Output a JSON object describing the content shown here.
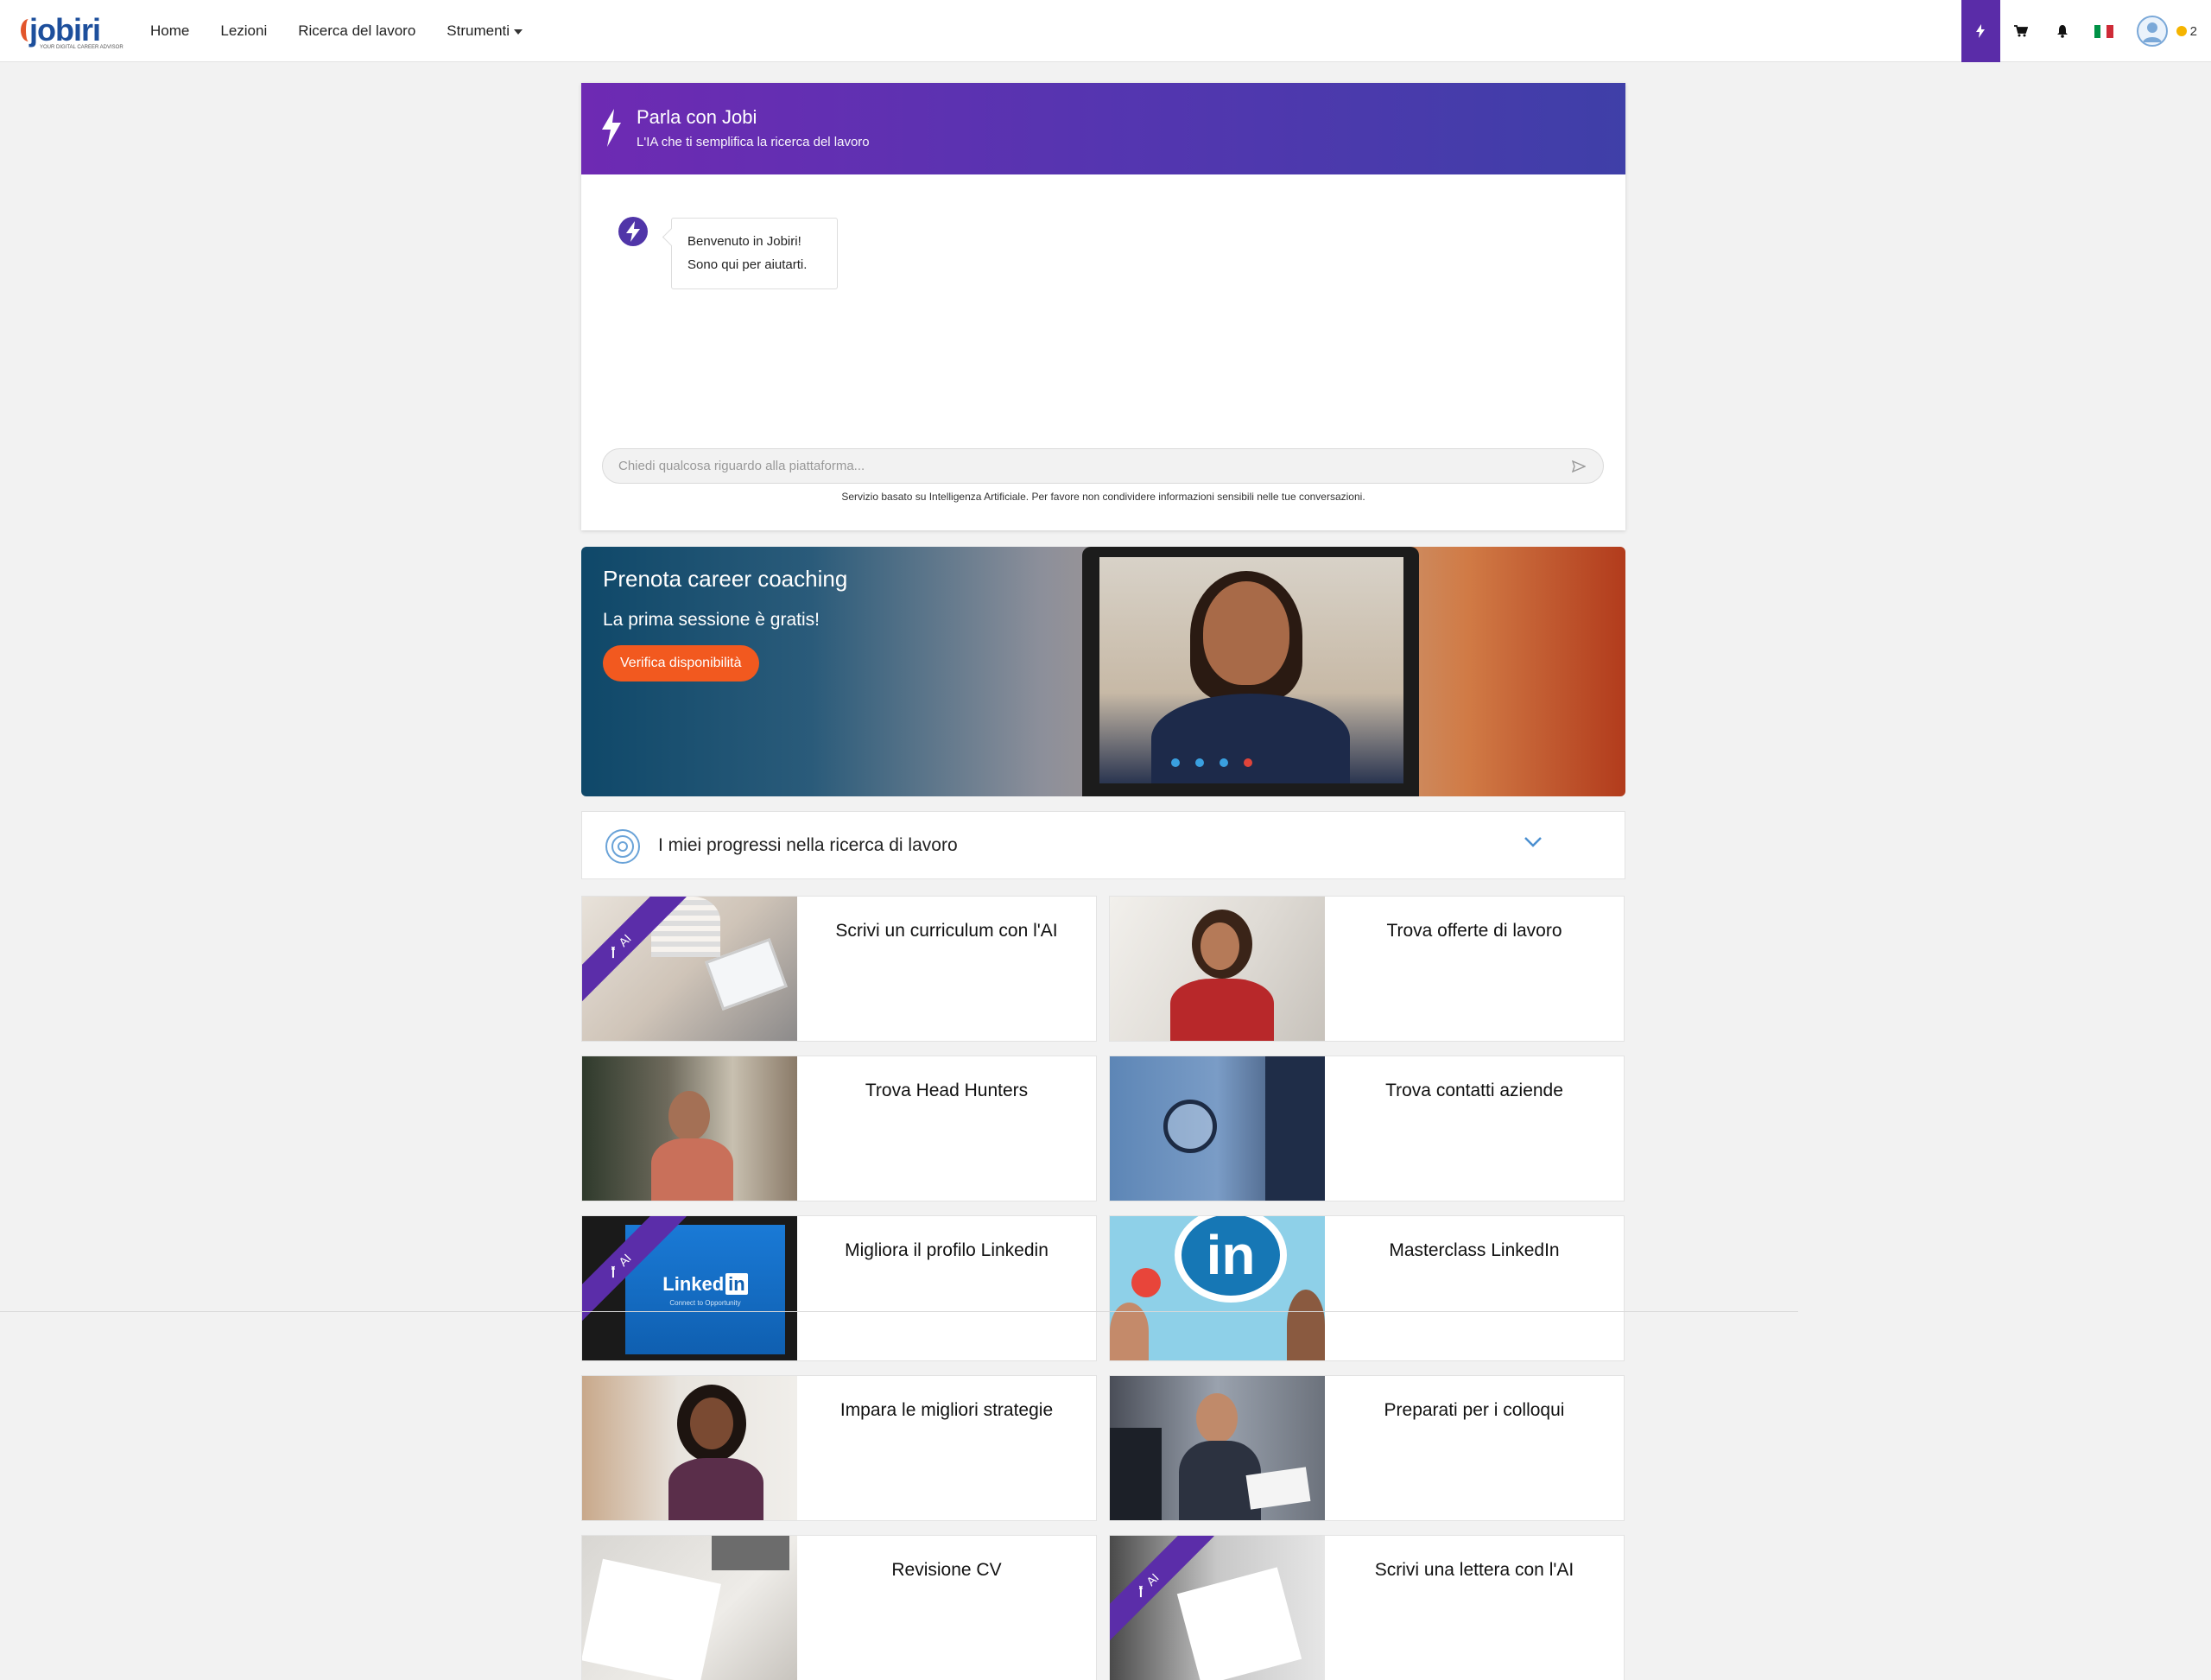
{
  "nav": {
    "logo_text": "jobiri",
    "logo_tagline": "YOUR DIGITAL CAREER ADVISOR",
    "links": [
      "Home",
      "Lezioni",
      "Ricerca del lavoro",
      "Strumenti"
    ],
    "coins": "2",
    "accent_color": "#5a2ca8"
  },
  "chat": {
    "title": "Parla con Jobi",
    "subtitle": "L'IA che ti semplifica la ricerca del lavoro",
    "welcome_line1": "Benvenuto in Jobiri!",
    "welcome_line2": "Sono qui per aiutarti.",
    "input_placeholder": "Chiedi qualcosa riguardo alla piattaforma...",
    "disclaimer": "Servizio basato su Intelligenza Artificiale. Per favore non condividere informazioni sensibili nelle tue conversazioni."
  },
  "coaching": {
    "title": "Prenota career coaching",
    "subtitle": "La prima sessione è gratis!",
    "button": "Verifica disponibilità",
    "button_color": "#f2591f"
  },
  "progress": {
    "label": "I miei progressi nella ricerca di lavoro"
  },
  "tiles": [
    {
      "title": "Scrivi un curriculum con l'AI",
      "ai": true,
      "ai_label": "AI"
    },
    {
      "title": "Trova offerte di lavoro",
      "ai": false
    },
    {
      "title": "Trova Head Hunters",
      "ai": false
    },
    {
      "title": "Trova contatti aziende",
      "ai": false
    },
    {
      "title": "Migliora il profilo Linkedin",
      "ai": true,
      "ai_label": "AI"
    },
    {
      "title": "Masterclass LinkedIn",
      "ai": false
    },
    {
      "title": "Impara le migliori strategie",
      "ai": false
    },
    {
      "title": "Preparati per i colloqui",
      "ai": false
    },
    {
      "title": "Revisione CV",
      "ai": false
    },
    {
      "title": "Scrivi una lettera con l'AI",
      "ai": true,
      "ai_label": "AI"
    }
  ],
  "linkedin_logo": "Linked",
  "linkedin_in": "in",
  "linkedin_tagline": "Connect to Opportunity"
}
